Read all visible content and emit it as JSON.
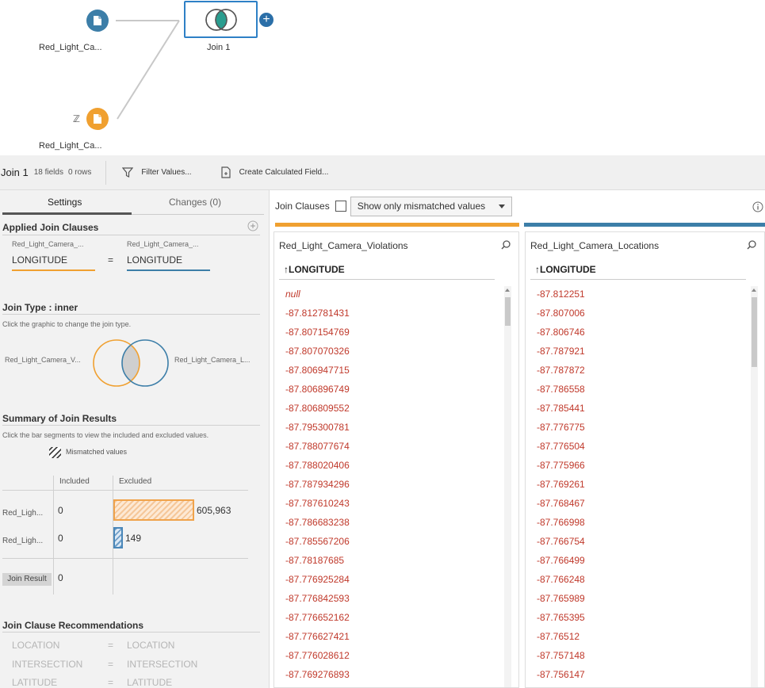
{
  "flow": {
    "source1_label": "Red_Light_Ca...",
    "source2_label": "Red_Light_Ca...",
    "join_label": "Join 1",
    "colors": {
      "source1": "#3c7ea8",
      "source2": "#f0a030",
      "join_border": "#2e80c6"
    }
  },
  "toolbar": {
    "step_name": "Join 1",
    "fields": "18 fields",
    "rows": "0 rows",
    "filter_label": "Filter Values...",
    "calc_label": "Create Calculated Field..."
  },
  "settings": {
    "tab_settings": "Settings",
    "tab_changes": "Changes (0)",
    "applied_title": "Applied Join Clauses",
    "left_source": "Red_Light_Camera_...",
    "right_source": "Red_Light_Camera_...",
    "left_field": "LONGITUDE",
    "operator": "=",
    "right_field": "LONGITUDE",
    "join_type_title": "Join Type : inner",
    "join_type_hint": "Click the graphic to change the join type.",
    "venn_left": "Red_Light_Camera_V...",
    "venn_right": "Red_Light_Camera_L...",
    "summary_title": "Summary of Join Results",
    "summary_hint": "Click the bar segments to view the included and excluded values.",
    "mismatched_legend": "Mismatched values",
    "col_included": "Included",
    "col_excluded": "Excluded",
    "row1_label": "Red_Ligh...",
    "row1_included": "0",
    "row1_excluded": "605,963",
    "row2_label": "Red_Ligh...",
    "row2_included": "0",
    "row2_excluded": "149",
    "result_label": "Join Result",
    "result_value": "0",
    "rec_title": "Join Clause Recommendations",
    "recommendations": [
      {
        "left": "LOCATION",
        "op": "=",
        "right": "LOCATION"
      },
      {
        "left": "INTERSECTION",
        "op": "=",
        "right": "INTERSECTION"
      },
      {
        "left": "LATITUDE",
        "op": "=",
        "right": "LATITUDE"
      }
    ]
  },
  "right": {
    "join_clauses_label": "Join Clauses",
    "mismatched_only": false,
    "filter_option": "Show only mismatched values",
    "left_panel": {
      "title": "Red_Light_Camera_Violations",
      "field": "LONGITUDE",
      "values": [
        "null",
        "-87.812781431",
        "-87.807154769",
        "-87.807070326",
        "-87.806947715",
        "-87.806896749",
        "-87.806809552",
        "-87.795300781",
        "-87.788077674",
        "-87.788020406",
        "-87.787934296",
        "-87.787610243",
        "-87.786683238",
        "-87.785567206",
        "-87.78187685",
        "-87.776925284",
        "-87.776842593",
        "-87.776652162",
        "-87.776627421",
        "-87.776028612",
        "-87.769276893"
      ]
    },
    "right_panel": {
      "title": "Red_Light_Camera_Locations",
      "field": "LONGITUDE",
      "values": [
        "-87.812251",
        "-87.807006",
        "-87.806746",
        "-87.787921",
        "-87.787872",
        "-87.786558",
        "-87.785441",
        "-87.776775",
        "-87.776504",
        "-87.775966",
        "-87.769261",
        "-87.768467",
        "-87.766998",
        "-87.766754",
        "-87.766499",
        "-87.766248",
        "-87.765989",
        "-87.765395",
        "-87.76512",
        "-87.757148",
        "-87.756147"
      ]
    },
    "colors": {
      "left": "#f0a030",
      "right": "#3c7ea8",
      "value": "#c0392b"
    }
  }
}
